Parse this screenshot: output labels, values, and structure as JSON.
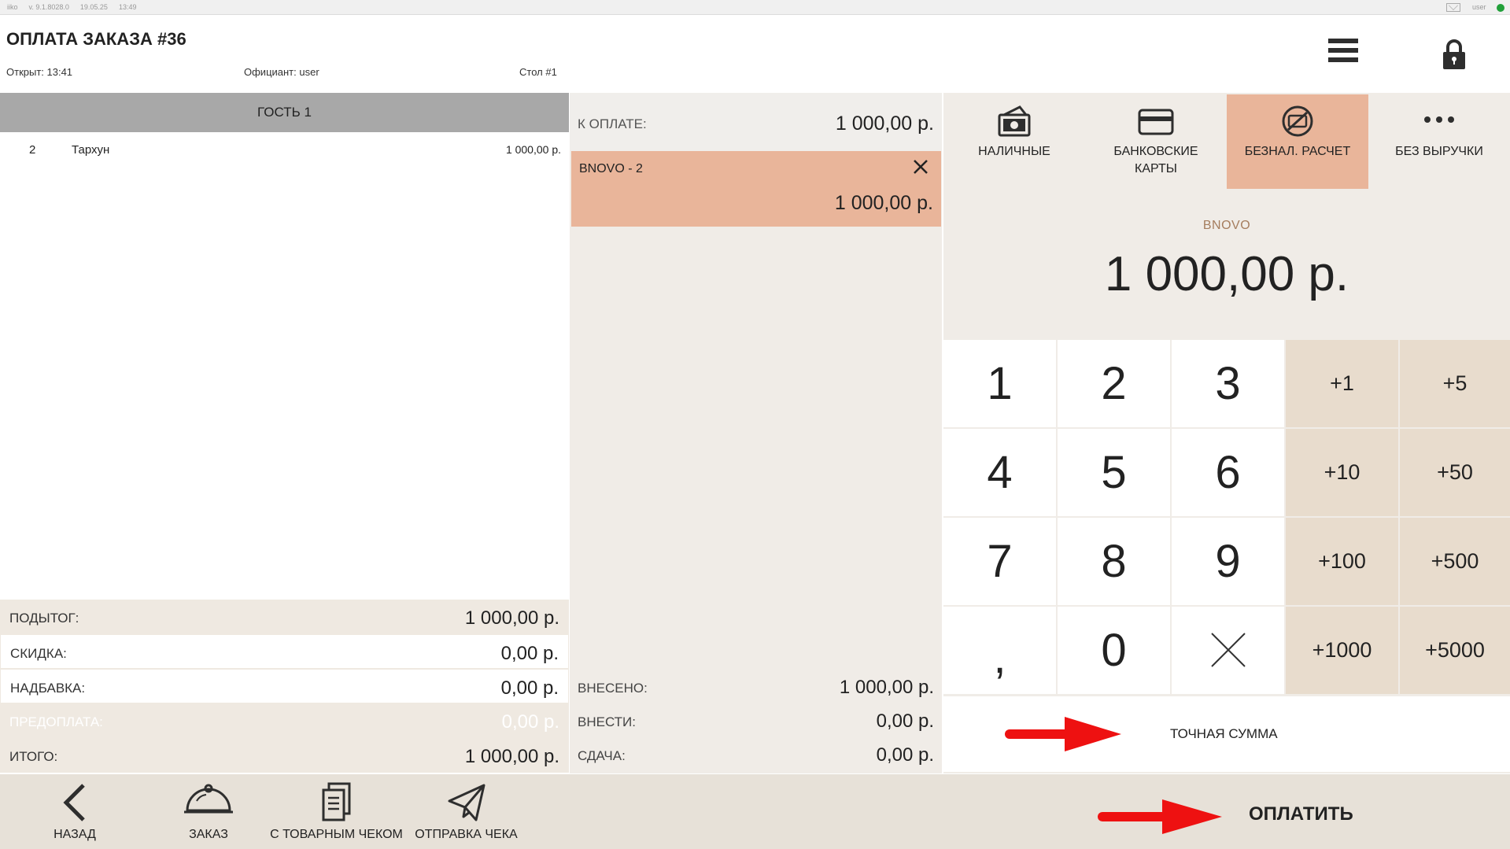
{
  "status_bar": {
    "app": "iiko",
    "version": "v. 9.1.8028.0",
    "date": "19.05.25",
    "time": "13:49",
    "user": "user"
  },
  "header": {
    "title": "ОПЛАТА ЗАКАЗА #36",
    "opened": "Открыт: 13:41",
    "waiter": "Официант: user",
    "table": "Стол #1"
  },
  "order": {
    "guest": "ГОСТЬ 1",
    "items": [
      {
        "qty": "2",
        "name": "Тархун",
        "sum": "1 000,00 р."
      }
    ]
  },
  "totals": {
    "subtotal_label": "ПОДЫТОГ:",
    "subtotal_value": "1 000,00 р.",
    "discount_label": "СКИДКА:",
    "discount_value": "0,00 р.",
    "surcharge_label": "НАДБАВКА:",
    "surcharge_value": "0,00 р.",
    "prepay_label": "ПРЕДОПЛАТА:",
    "prepay_value": "0,00 р.",
    "total_label": "ИТОГО:",
    "total_value": "1 000,00 р."
  },
  "payment": {
    "to_pay_label": "К ОПЛАТЕ:",
    "to_pay_value": "1 000,00 р.",
    "selected_name": "BNOVO - 2",
    "selected_amount": "1 000,00 р.",
    "deposited_label": "ВНЕСЕНО:",
    "deposited_value": "1 000,00 р.",
    "to_deposit_label": "ВНЕСТИ:",
    "to_deposit_value": "0,00 р.",
    "change_label": "СДАЧА:",
    "change_value": "0,00 р."
  },
  "methods": {
    "cash": "НАЛИЧНЫЕ",
    "cards": "БАНКОВСКИЕ КАРТЫ",
    "noncash": "БЕЗНАЛ. РАСЧЕТ",
    "no_revenue": "БЕЗ ВЫРУЧКИ"
  },
  "entry": {
    "name": "BNOVO",
    "amount": "1 000,00 р."
  },
  "keypad": {
    "k1": "1",
    "k2": "2",
    "k3": "3",
    "k4": "4",
    "k5": "5",
    "k6": "6",
    "k7": "7",
    "k8": "8",
    "k9": "9",
    "comma": ",",
    "k0": "0",
    "p1": "+1",
    "p5": "+5",
    "p10": "+10",
    "p50": "+50",
    "p100": "+100",
    "p500": "+500",
    "p1000": "+1000",
    "p5000": "+5000",
    "exact": "ТОЧНАЯ СУММА"
  },
  "toolbar": {
    "back": "НАЗАД",
    "order": "ЗАКАЗ",
    "with_receipt": "С ТОВАРНЫМ ЧЕКОМ",
    "send_receipt": "ОТПРАВКА ЧЕКА",
    "pay": "ОПЛАТИТЬ"
  },
  "colors": {
    "accent_active": "#e9b59a",
    "quick_add": "#e8dccd",
    "panel_bg": "#f0ece7",
    "arrow": "#ee1111"
  }
}
